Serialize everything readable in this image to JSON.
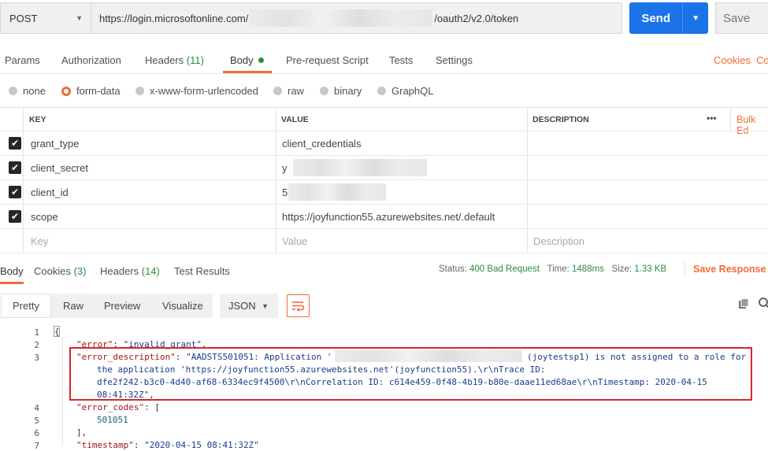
{
  "request": {
    "method": "POST",
    "url_prefix": "https://login.microsoftonline.com/",
    "url_suffix": "/oauth2/v2.0/token",
    "send_label": "Send",
    "save_label": "Save"
  },
  "request_tabs": {
    "params": "Params",
    "authorization": "Authorization",
    "headers": "Headers",
    "headers_count": "(11)",
    "body": "Body",
    "prerequest": "Pre-request Script",
    "tests": "Tests",
    "settings": "Settings",
    "cookies": "Cookies",
    "code": "Co"
  },
  "body_types": {
    "none": "none",
    "form_data": "form-data",
    "urlencoded": "x-www-form-urlencoded",
    "raw": "raw",
    "binary": "binary",
    "graphql": "GraphQL"
  },
  "kv_table": {
    "col_key": "KEY",
    "col_value": "VALUE",
    "col_desc": "DESCRIPTION",
    "more": "•••",
    "bulk_edit": "Bulk Ed",
    "rows": [
      {
        "key": "grant_type",
        "value": "client_credentials"
      },
      {
        "key": "client_secret",
        "value": "y"
      },
      {
        "key": "client_id",
        "value": "5"
      },
      {
        "key": "scope",
        "value": "https://joyfunction55.azurewebsites.net/.default"
      }
    ],
    "placeholder_key": "Key",
    "placeholder_value": "Value",
    "placeholder_desc": "Description"
  },
  "response_tabs": {
    "body": "Body",
    "cookies": "Cookies",
    "cookies_count": "(3)",
    "headers": "Headers",
    "headers_count": "(14)",
    "test_results": "Test Results"
  },
  "response_status": {
    "status_label": "Status:",
    "status_value": "400 Bad Request",
    "time_label": "Time:",
    "time_value": "1488ms",
    "size_label": "Size:",
    "size_value": "1.33 KB",
    "save_response": "Save Response"
  },
  "view_modes": {
    "pretty": "Pretty",
    "raw": "Raw",
    "preview": "Preview",
    "visualize": "Visualize",
    "format": "JSON"
  },
  "code": {
    "line_numbers": [
      "1",
      "2",
      "3",
      "4",
      "5",
      "6",
      "7"
    ],
    "l1": "{",
    "l2_key": "\"error\"",
    "l2_val": "\"invalid_grant\"",
    "l3_key": "\"error_description\"",
    "l3_val_a": "\"AADSTS501051: Application '",
    "l3_val_b": "(joytestsp1) is not assigned to a role for",
    "l3_cont1": "the application 'https://joyfunction55.azurewebsites.net'(joyfunction55).\\r\\nTrace ID:",
    "l3_cont2": "dfe2f242-b3c0-4d40-af68-6334ec9f4500\\r\\nCorrelation ID: c614e459-0f48-4b19-b80e-daae11ed68ae\\r\\nTimestamp: 2020-04-15",
    "l3_cont3": "08:41:32Z\"",
    "l4_key": "\"error_codes\"",
    "l5_val": "501051",
    "l6": "],",
    "l7_key": "\"timestamp\"",
    "l7_val": "\"2020-04-15 08:41:32Z\""
  },
  "colors": {
    "accent": "#f26b3a",
    "send_blue": "#1a73e8",
    "count_green": "#2e8b3c",
    "highlight_red": "#d9262b"
  }
}
